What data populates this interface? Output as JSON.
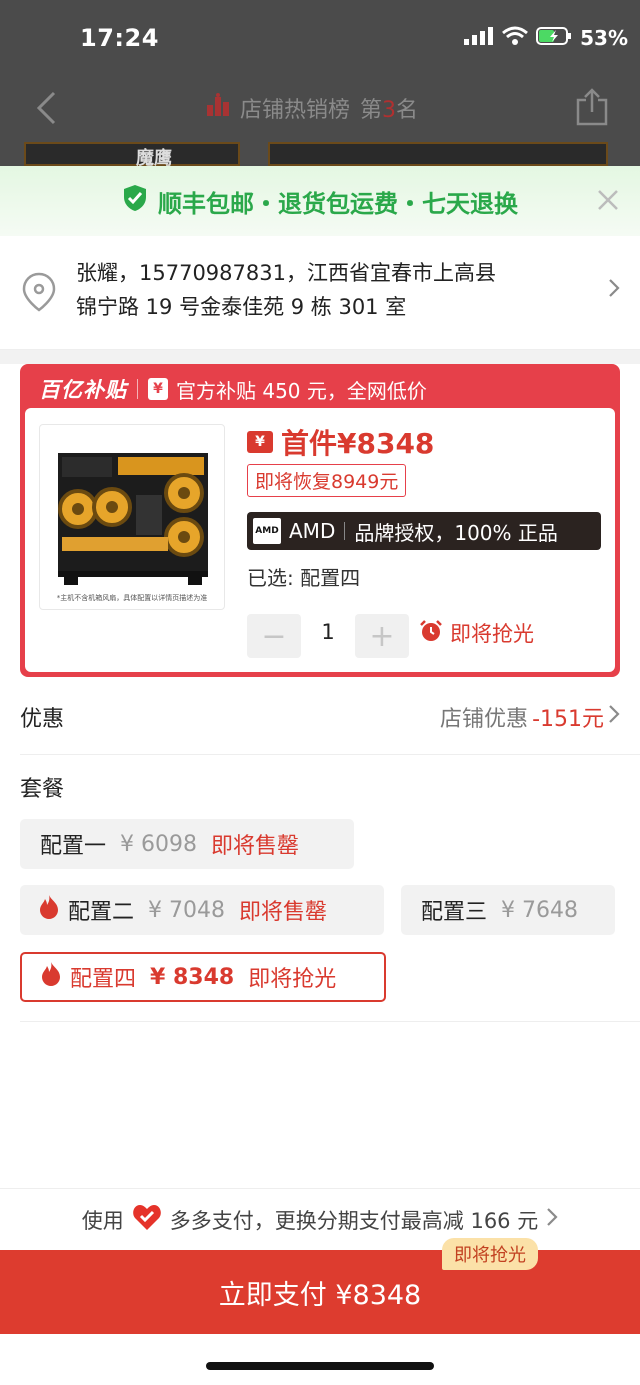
{
  "status_bar": {
    "time": "17:24",
    "battery": "53%"
  },
  "nav": {
    "title_prefix": "店铺热销榜",
    "rank_prefix": "第",
    "rank_number": "3",
    "rank_suffix": "名"
  },
  "background": {
    "thumb_text": "魔鹰"
  },
  "banner": {
    "text": "顺丰包邮・退货包运费・七天退换"
  },
  "address": {
    "line1": "张耀，15770987831，江西省宜春市上高县",
    "line2": "锦宁路 19 号金泰佳苑 9 栋 301 室"
  },
  "promo": {
    "logo": "百亿补贴",
    "ticket_glyph": "¥",
    "text": "官方补贴 450 元，全网低价",
    "price_tag": "¥",
    "price": "首件¥8348",
    "restore": "即将恢复8949元",
    "brand_logo": "AMD",
    "brand_name": "AMD",
    "brand_desc": "品牌授权，100% 正品",
    "selected": "已选: 配置四",
    "product_caption": "*主机不含机箱风扇，具体配置以详情页描述为准",
    "qty_minus": "−",
    "qty_plus": "+",
    "quantity": "1",
    "qty_status": "即将抢光"
  },
  "discount": {
    "label": "优惠",
    "prefix": "店铺优惠",
    "amount": "-151元"
  },
  "package": {
    "title": "套餐",
    "options": [
      {
        "name": "配置一",
        "price": "¥ 6098",
        "status": "即将售罄"
      },
      {
        "name": "配置二",
        "price": "¥ 7048",
        "status": "即将售罄"
      },
      {
        "name": "配置三",
        "price": "¥ 7648",
        "status": ""
      },
      {
        "name": "配置四",
        "price": "¥ 8348",
        "status": "即将抢光"
      }
    ]
  },
  "pay_hint": {
    "prefix": "使用",
    "text": "多多支付，更换分期支付最高减 166 元"
  },
  "pay_button": {
    "label": "立即支付 ¥8348",
    "badge": "即将抢光"
  },
  "colors": {
    "accent": "#dd3c2f",
    "green": "#2aa84a",
    "promo": "#e6404a"
  }
}
